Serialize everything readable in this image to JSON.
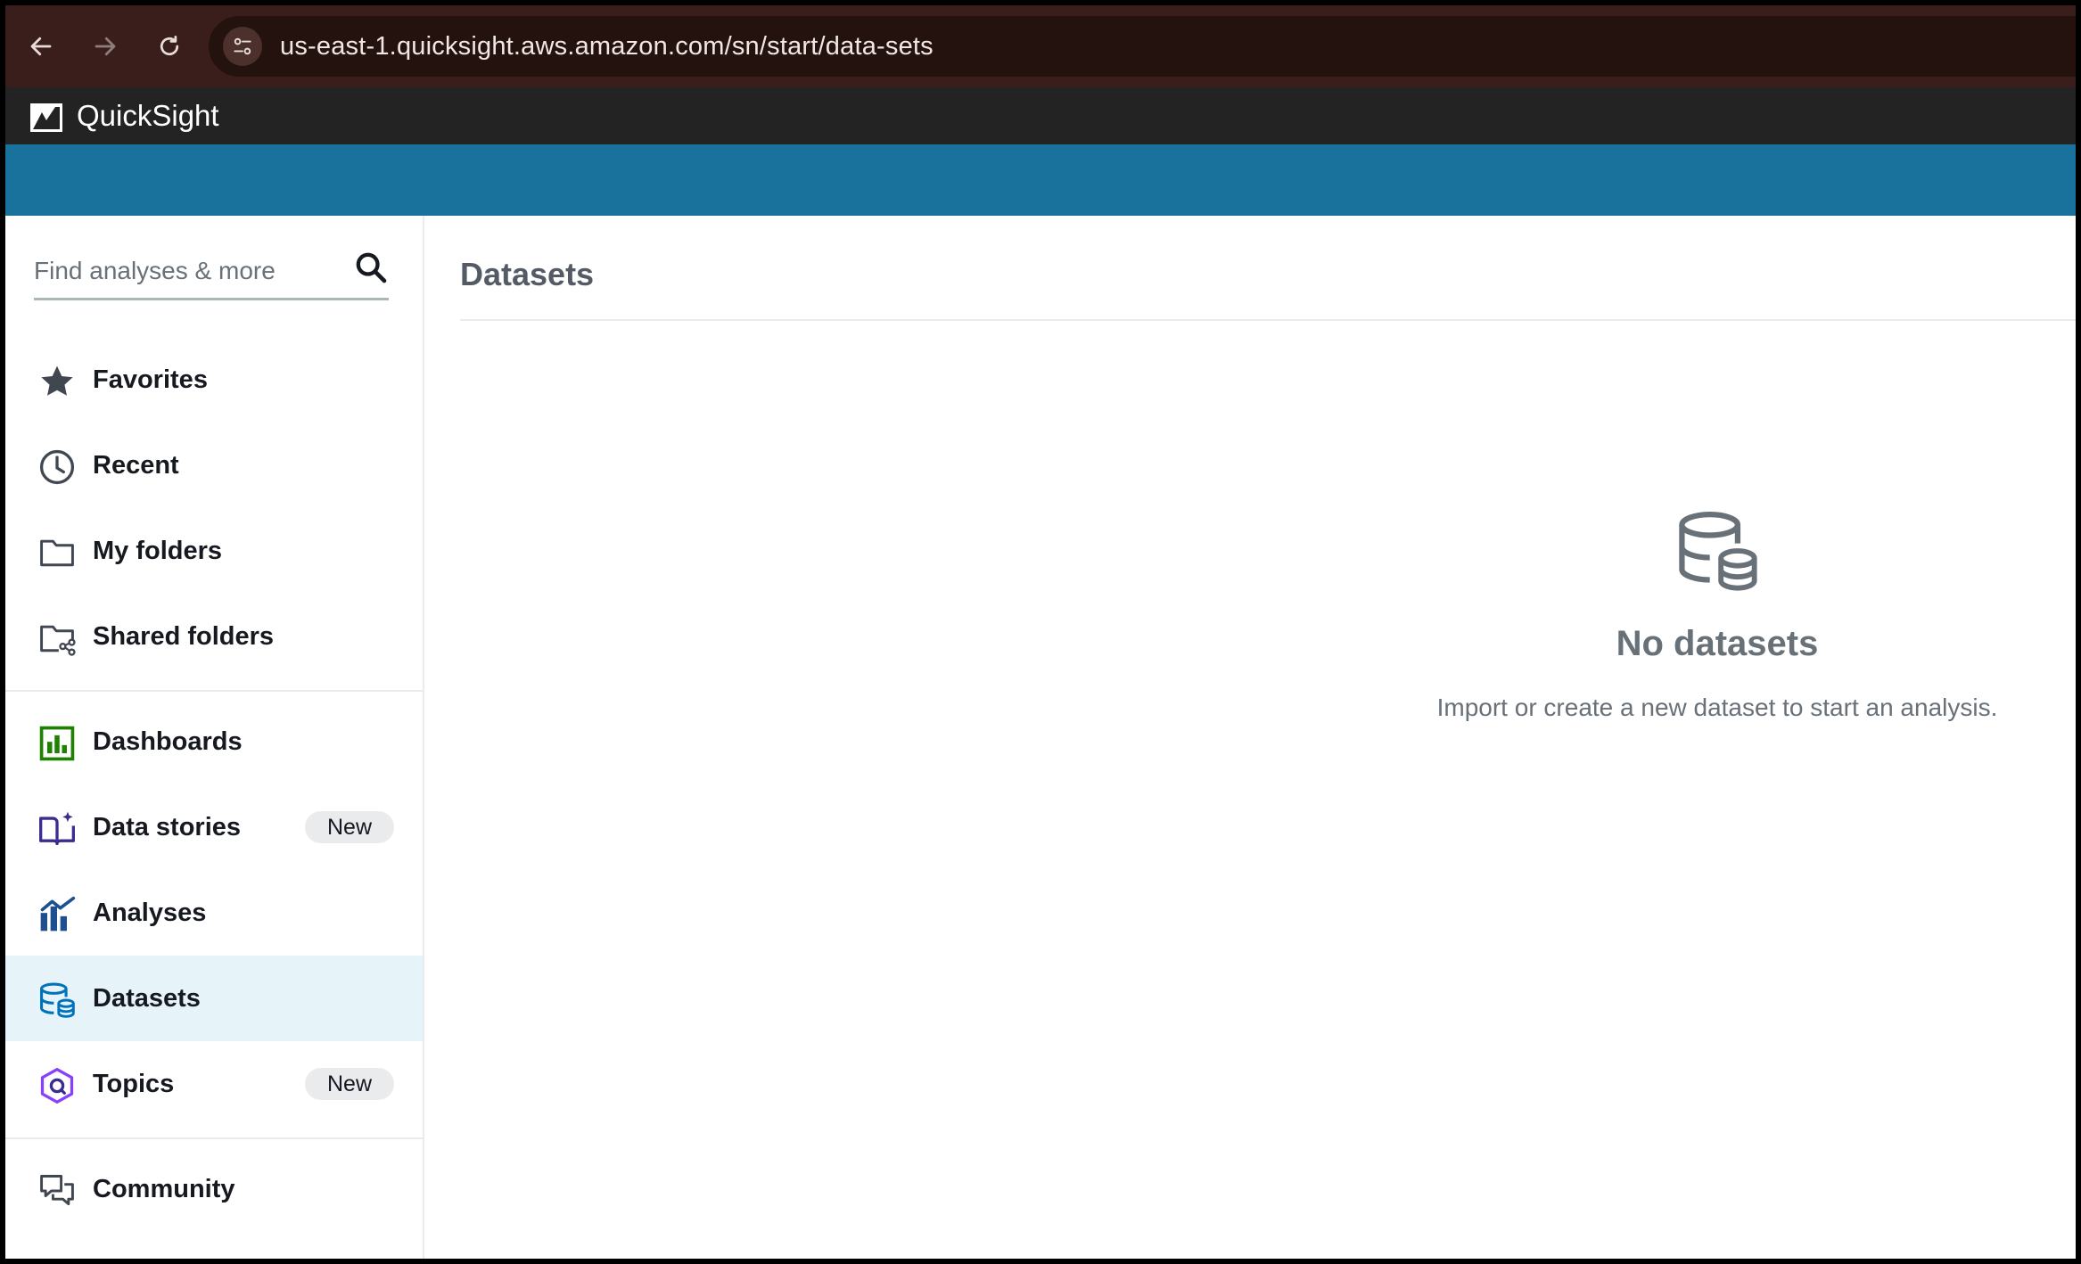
{
  "browser": {
    "url": "us-east-1.quicksight.aws.amazon.com/sn/start/data-sets",
    "icons": [
      "back-arrow-icon",
      "forward-arrow-icon",
      "reload-icon",
      "site-settings-icon"
    ]
  },
  "app": {
    "title": "QuickSight",
    "header_color": "#232323",
    "band_color": "#19729b"
  },
  "sidebar": {
    "search_placeholder": "Find analyses & more",
    "items": [
      {
        "label": "Favorites",
        "icon": "star-icon"
      },
      {
        "label": "Recent",
        "icon": "clock-icon"
      },
      {
        "label": "My folders",
        "icon": "folder-icon"
      },
      {
        "label": "Shared folders",
        "icon": "shared-folder-icon"
      },
      {
        "label": "Dashboards",
        "icon": "dashboard-icon"
      },
      {
        "label": "Data stories",
        "icon": "data-story-icon",
        "badge": "New"
      },
      {
        "label": "Analyses",
        "icon": "analysis-icon"
      },
      {
        "label": "Datasets",
        "icon": "dataset-icon",
        "active": true
      },
      {
        "label": "Topics",
        "icon": "topic-icon",
        "badge": "New"
      },
      {
        "label": "Community",
        "icon": "community-icon"
      }
    ]
  },
  "main": {
    "title": "Datasets",
    "empty_state": {
      "icon": "database-icon",
      "title": "No datasets",
      "subtitle": "Import or create a new dataset to start an analysis."
    }
  }
}
